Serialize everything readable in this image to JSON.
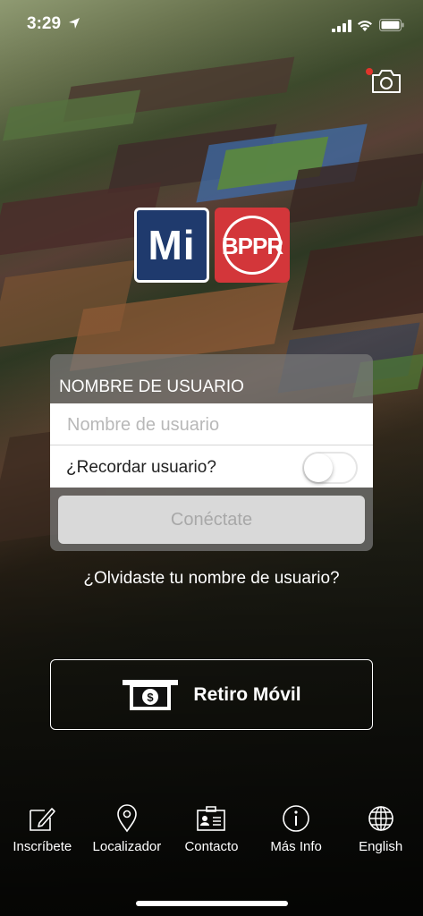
{
  "status_bar": {
    "time": "3:29"
  },
  "logos": {
    "mi_text": "Mi",
    "bppr_text": "BPPR"
  },
  "login": {
    "header": "NOMBRE DE USUARIO",
    "username_value": "",
    "username_placeholder": "Nombre de usuario",
    "remember_label": "¿Recordar usuario?",
    "remember_enabled": false,
    "connect_label": "Conéctate"
  },
  "forgot_link": "¿Olvidaste tu nombre de usuario?",
  "retiro": {
    "label": "Retiro Móvil",
    "icon": "cash-withdraw-icon"
  },
  "tabbar": {
    "items": [
      {
        "label": "Inscríbete",
        "icon": "edit-icon"
      },
      {
        "label": "Localizador",
        "icon": "location-pin-icon"
      },
      {
        "label": "Contacto",
        "icon": "contact-card-icon"
      },
      {
        "label": "Más Info",
        "icon": "info-icon"
      },
      {
        "label": "English",
        "icon": "globe-icon"
      }
    ]
  },
  "colors": {
    "mi_blue": "#1f3a6d",
    "bppr_red": "#d3363a",
    "notification_red": "#e0352b"
  }
}
